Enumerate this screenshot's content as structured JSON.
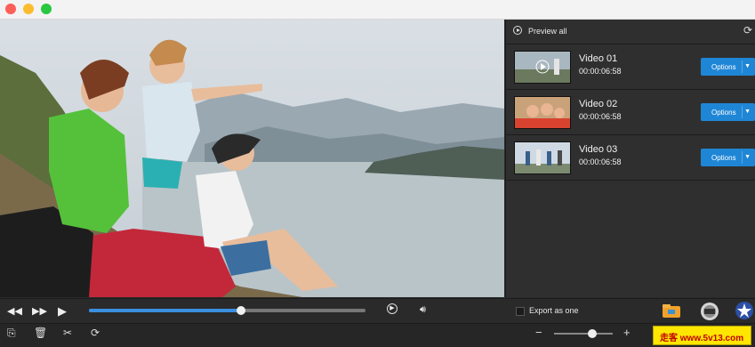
{
  "window": {
    "traffic_lights": [
      "close",
      "minimize",
      "zoom"
    ]
  },
  "preview_panel": {
    "header_label": "Preview all",
    "icon": "refresh-icon"
  },
  "videos": [
    {
      "name": "Video 01",
      "duration": "00:00:06:58",
      "options_label": "Options"
    },
    {
      "name": "Video 02",
      "duration": "00:00:06:58",
      "options_label": "Options"
    },
    {
      "name": "Video 03",
      "duration": "00:00:06:58",
      "options_label": "Options"
    }
  ],
  "player": {
    "progress_fraction": 0.55,
    "icons": [
      "rewind-icon",
      "fast-forward-icon",
      "play-icon",
      "preview-play-icon",
      "volume-icon"
    ]
  },
  "export": {
    "export_as_one_label": "Export as one",
    "export_as_one_checked": false
  },
  "toolbar": {
    "icons": [
      "import-icon",
      "delete-icon",
      "crop-icon",
      "rotate-icon",
      "zoom-out-icon",
      "zoom-in-icon"
    ],
    "zoom_fraction": 0.65
  },
  "watermark": {
    "text": "走客 www.5v13.com"
  },
  "colors": {
    "accent": "#1f86d6",
    "panel": "#2f2f2f",
    "titlebar": "#f3f3f3"
  }
}
